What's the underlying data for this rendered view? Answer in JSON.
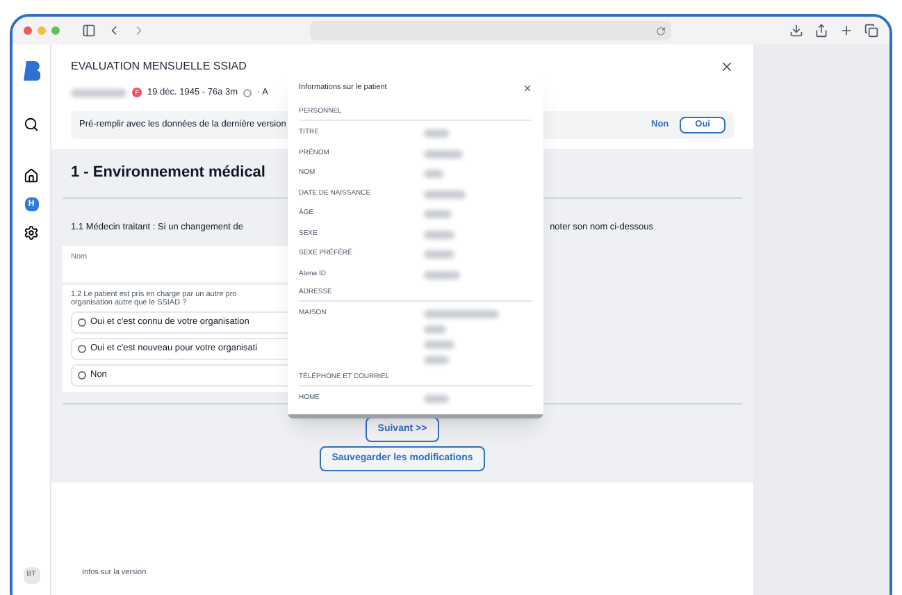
{
  "header": {
    "title": "EVALUATION MENSUELLE SSIAD",
    "gender_badge": "F",
    "birth": "19 déc. 1945 - 76a 3m",
    "trailing": "· A"
  },
  "sidebar": {
    "hospital_badge": "H"
  },
  "prefill": {
    "text": "Pré-remplir avec les données de la dernière version",
    "buttons": [
      {
        "label": "Non",
        "selected": false
      },
      {
        "label": "Oui",
        "selected": true
      }
    ]
  },
  "section": {
    "title": "1 - Environnement médical",
    "q1_start": "1.1 Médecin traitant : Si un changement de",
    "q1_end": "noter son nom ci-dessous",
    "name_field": {
      "placeholder": "Nom"
    },
    "q2": "1.2 Le patient est pris en charge par un autre pro\norganisation autre que le SSIAD ?",
    "options": [
      {
        "label": "Oui et c'est connu de votre organisation",
        "selected": false
      },
      {
        "label": "Oui et c'est nouveau pour votre organisati",
        "selected": false
      },
      {
        "label": "Non",
        "selected": false
      }
    ]
  },
  "actions": [
    "Suivant >>",
    "Sauvegarder les modifications"
  ],
  "footer": {
    "version_link": "Infos sur la version",
    "avatar": "BT"
  },
  "popover": {
    "title": "Informations sur le patient",
    "groups": [
      {
        "heading": "PERSONNEL",
        "rows": [
          {
            "label": "TITRE",
            "kind": "single"
          },
          {
            "label": "PRÉNOM",
            "kind": "single"
          },
          {
            "label": "NOM",
            "kind": "single"
          },
          {
            "label": "DATE DE NAISSANCE",
            "kind": "single"
          },
          {
            "label": "ÂGE",
            "kind": "single"
          },
          {
            "label": "SEXE",
            "kind": "single"
          },
          {
            "label": "SEXE PRÉFÉRÉ",
            "kind": "single"
          },
          {
            "label": "Atena ID",
            "kind": "single"
          }
        ]
      },
      {
        "heading": "ADRESSE",
        "rows": [
          {
            "label": "MAISON",
            "kind": "address"
          }
        ]
      },
      {
        "heading": "TÉLÉPHONE ET COURRIEL",
        "rows": [
          {
            "label": "HOME",
            "kind": "single"
          }
        ]
      }
    ]
  }
}
